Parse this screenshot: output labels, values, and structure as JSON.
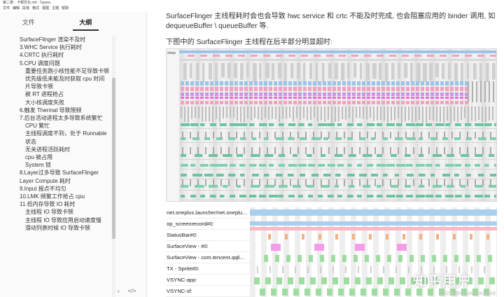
{
  "window": {
    "title": "第二章：卡顿优化.md - Typora"
  },
  "menubar": [
    "文件",
    "编辑",
    "段落",
    "格式",
    "视图",
    "主题",
    "帮助"
  ],
  "sidebar": {
    "tabs": [
      {
        "label": "文件",
        "active": false
      },
      {
        "label": "大纲",
        "active": true
      }
    ],
    "outline": [
      {
        "label": "SurfaceFlinger 渲染不及时",
        "level": 2
      },
      {
        "label": "3.WHC Service 执行耗时",
        "level": 2
      },
      {
        "label": "4.CRTC 执行耗时",
        "level": 2
      },
      {
        "label": "5.CPU 调度问题",
        "level": 2
      },
      {
        "label": "重要任务跑小核性能不足导致卡顿",
        "level": 3
      },
      {
        "label": "优先级低未能及时获取 cpu 时间片导致卡顿",
        "level": 3
      },
      {
        "label": "被 RT 进程抢占",
        "level": 3
      },
      {
        "label": "大小核调度失败",
        "level": 3
      },
      {
        "label": "6.触发 Thermal 导致限频",
        "level": 2
      },
      {
        "label": "7.后台活动进程太多导致系统繁忙",
        "level": 2
      },
      {
        "label": "CPU 繁忙",
        "level": 3
      },
      {
        "label": "主线程调度不到，处于 Runnable 状态",
        "level": 3
      },
      {
        "label": "无关进程活跃耗时",
        "level": 3
      },
      {
        "label": "cpu 被占用",
        "level": 3
      },
      {
        "label": "System 锁",
        "level": 3
      },
      {
        "label": "8.Layer过多导致 SurfaceFlinger Layer Compute 耗时",
        "level": 2
      },
      {
        "label": "9.Input 报点不均匀",
        "level": 2
      },
      {
        "label": "10.LMK 频繁工作抢占 cpu",
        "level": 2
      },
      {
        "label": "11.低内存导致 IO 耗时",
        "level": 2
      },
      {
        "label": "主线程 IO 导致卡顿",
        "level": 3
      },
      {
        "label": "主线程 IO 导致应用启动速度慢",
        "level": 3
      },
      {
        "label": "滑动列表时候 IO 导致卡顿",
        "level": 3
      }
    ],
    "bottom_icons": [
      "chevron-left-icon",
      "code-icon"
    ]
  },
  "main": {
    "paragraph1": "SurfaceFlinger 主线程耗时会也会导致 hwc service 和 crtc 不能及时完成, 也会阻塞应用的 binder 调用, 如 dequeueBuffer \\ queueBuffer 等.",
    "paragraph2": "下图中的 SurfaceFlinger 主线程在后半部分明显超时:",
    "trace1_label": "sleep",
    "trace2_labels": [
      "net.oneplus.launcher/net.oneplu...",
      "op_screenrecord#0:",
      "StatusBar#0:",
      "SurfaceView - #0:",
      "SurfaceView - com.tencent.qqli...",
      "TX - Sprite#0:",
      "VSYNC-app:",
      "VSYNC-sf:"
    ],
    "watermark": "知乎用户",
    "watermark_small": "CSDN @Gracker-Android"
  },
  "colors": {
    "track_green": "#7fd1ae",
    "track_pink": "#f2a2bc",
    "track_blue": "#9cc4ea",
    "track_purple": "#c797e6",
    "track_magenta": "#e86cd9",
    "track_gray": "#cfcfcf",
    "layer_blue": "#a8d0ee",
    "layer_pink": "#f7b9c2",
    "layer_orange": "#f4b183",
    "layer_magenta": "#f59de9",
    "layer_green": "#9fdc9f"
  }
}
